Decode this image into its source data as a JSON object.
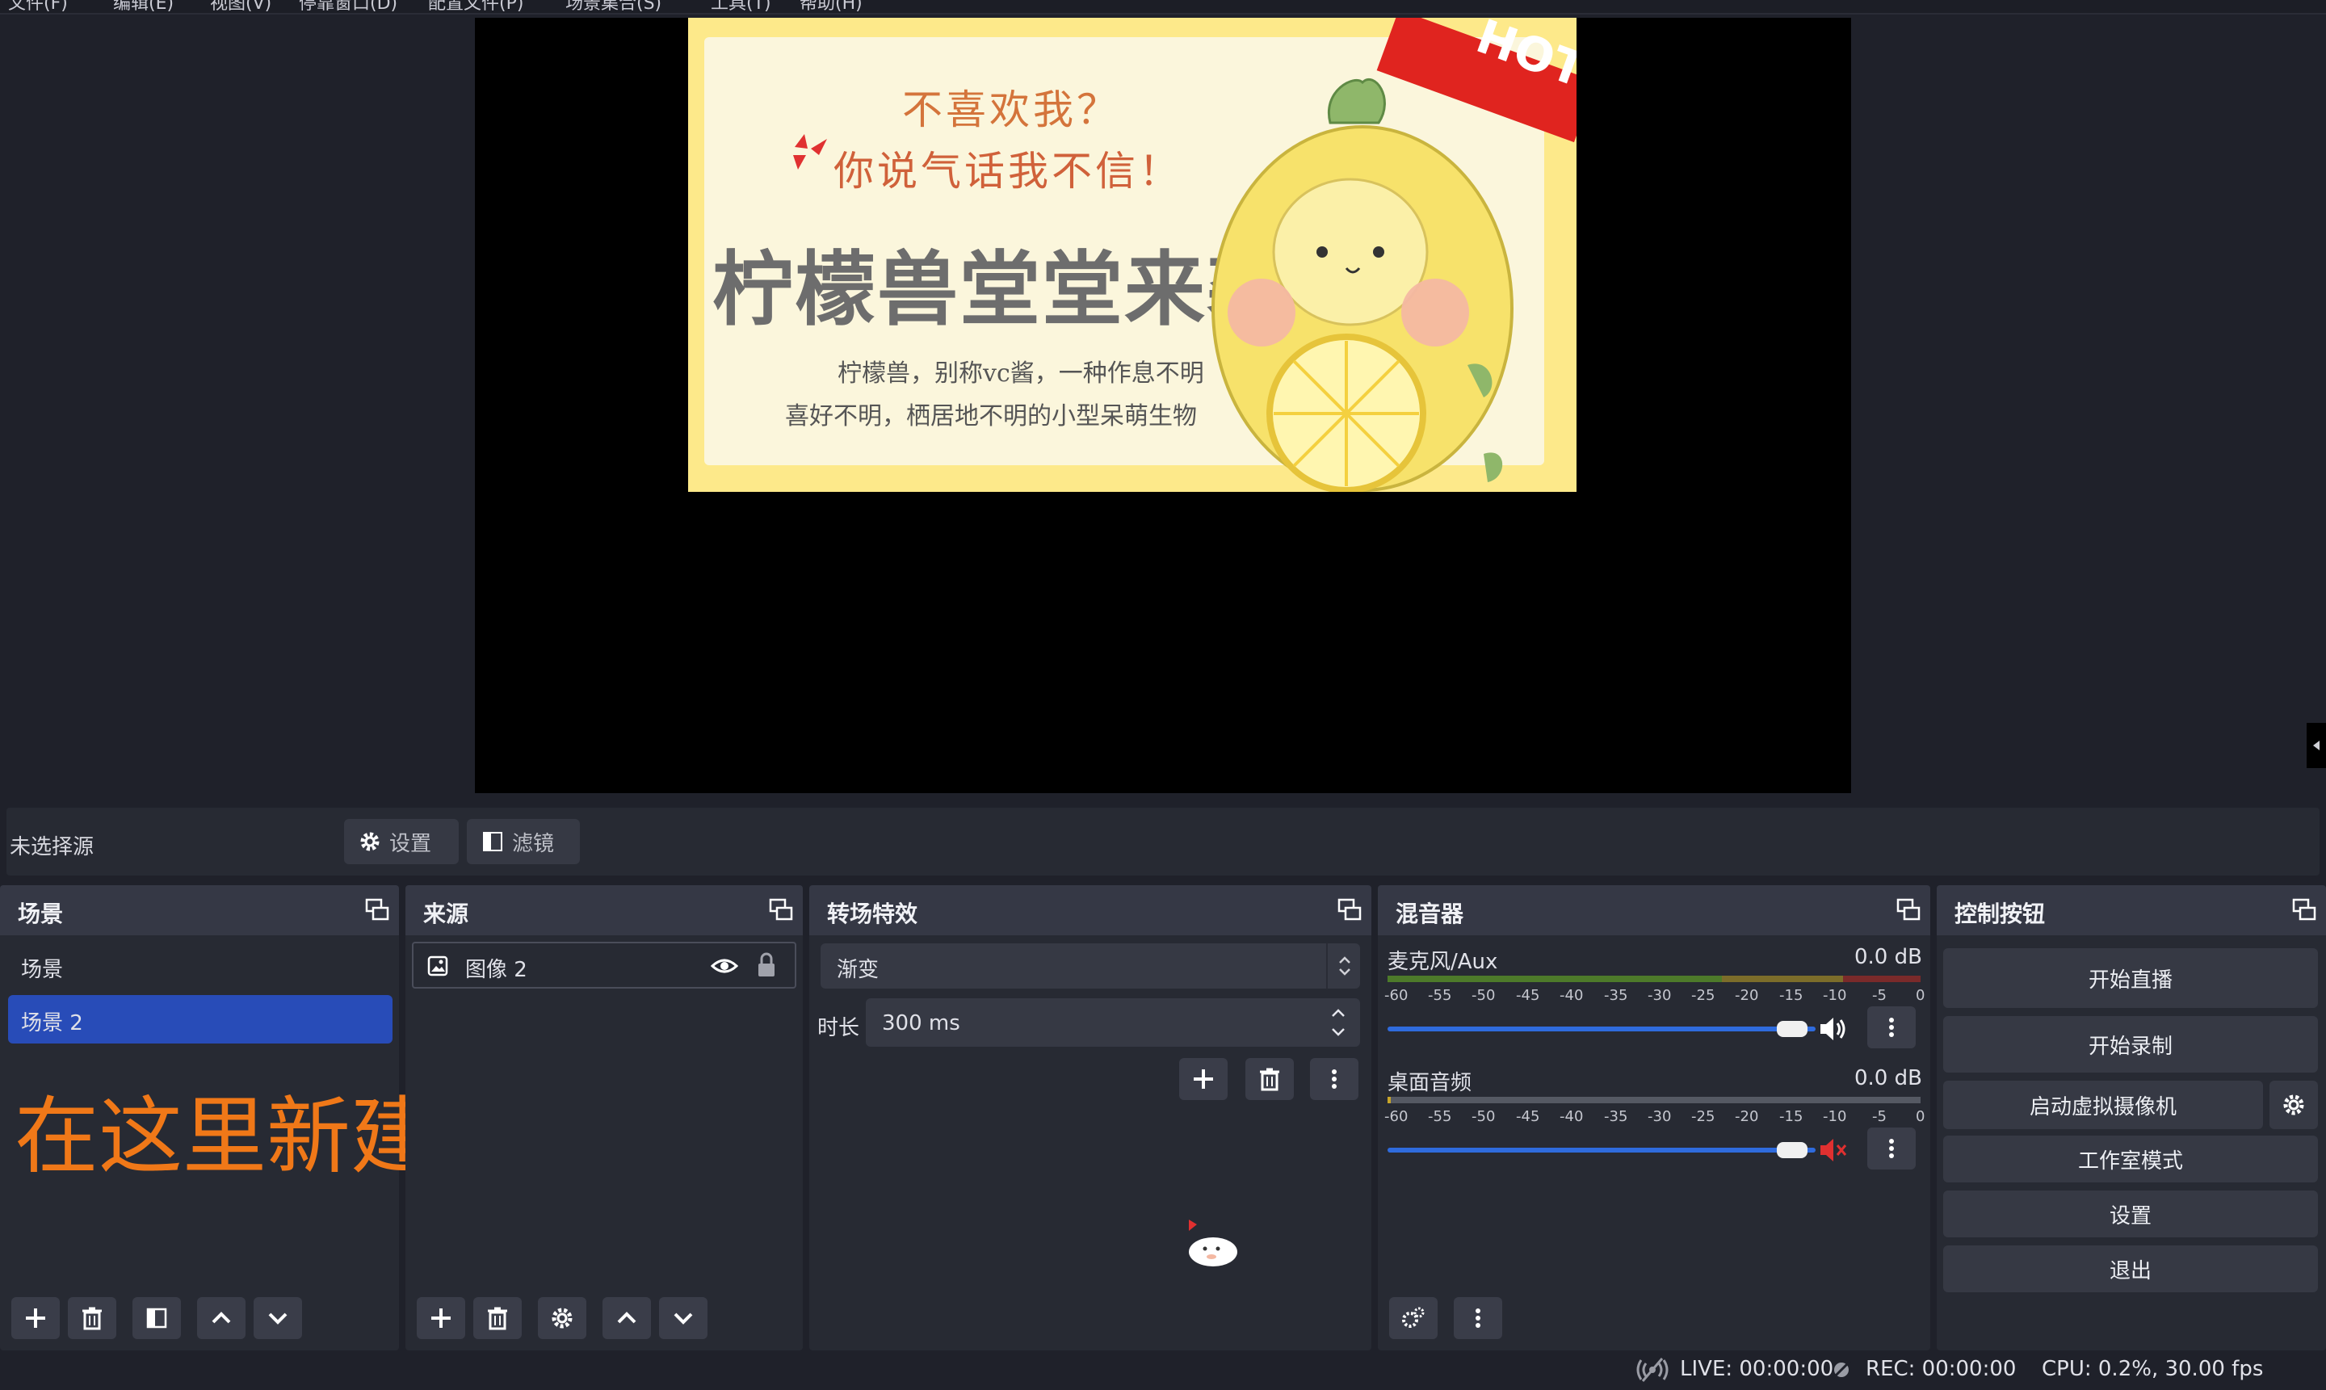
{
  "menubar": {
    "items": [
      "文件(F)",
      "编辑(E)",
      "视图(V)",
      "停靠窗口(D)",
      "配置文件(P)",
      "场景集合(S)",
      "工具(T)",
      "帮助(H)"
    ]
  },
  "preview": {
    "image": {
      "hot_label": "HOT",
      "line1": "不喜欢我？",
      "line2": "你说气话我不信！",
      "big_title": "柠檬兽堂堂来袭",
      "desc1": "柠檬兽，别称vc酱，一种作息不明",
      "desc2": "喜好不明，栖居地不明的小型呆萌生物"
    }
  },
  "source_toolbar": {
    "no_source": "未选择源",
    "settings_label": "设置",
    "filters_label": "滤镜"
  },
  "scenes": {
    "title": "场景",
    "items": [
      "场景",
      "场景 2"
    ],
    "selected_index": 1
  },
  "annotation": "在这里新建场景",
  "sources": {
    "title": "来源",
    "items": [
      {
        "name": "图像 2",
        "visible": true,
        "locked": true
      }
    ]
  },
  "transitions": {
    "title": "转场特效",
    "current": "渐变",
    "duration_label": "时长",
    "duration_value": "300 ms"
  },
  "mixer": {
    "title": "混音器",
    "scale": [
      "-60",
      "-55",
      "-50",
      "-45",
      "-40",
      "-35",
      "-30",
      "-25",
      "-20",
      "-15",
      "-10",
      "-5",
      "0"
    ],
    "channels": [
      {
        "name": "麦克风/Aux",
        "db": "0.0 dB",
        "muted": false,
        "volume": 1.0
      },
      {
        "name": "桌面音频",
        "db": "0.0 dB",
        "muted": true,
        "volume": 1.0
      }
    ]
  },
  "controls": {
    "title": "控制按钮",
    "start_stream": "开始直播",
    "start_record": "开始录制",
    "virtual_cam": "启动虚拟摄像机",
    "studio_mode": "工作室模式",
    "settings": "设置",
    "exit": "退出"
  },
  "status": {
    "live": "LIVE: 00:00:00",
    "rec": "REC: 00:00:00",
    "cpu": "CPU: 0.2%, 30.00 fps"
  },
  "colors": {
    "accent": "#284cb8",
    "annotation": "#f07818",
    "hot": "#e0241f",
    "mute": "#e03030"
  }
}
